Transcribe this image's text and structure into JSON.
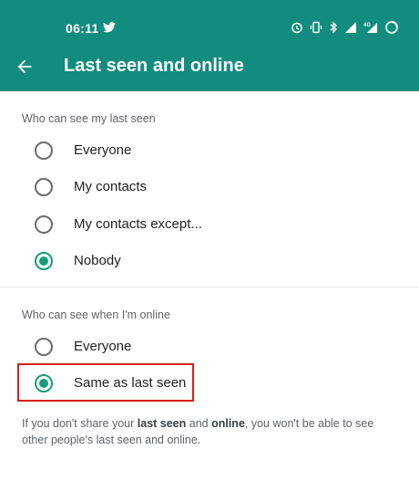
{
  "status_bar": {
    "time": "06:11",
    "icons": [
      "twitter-icon",
      "alarm-icon",
      "vibrate-icon",
      "bluetooth-icon",
      "signal-icon",
      "4g-icon",
      "battery-icon"
    ]
  },
  "header": {
    "title": "Last seen and online",
    "color": "#128c7e"
  },
  "last_seen": {
    "section_title": "Who can see my last seen",
    "options": [
      {
        "label": "Everyone",
        "selected": false
      },
      {
        "label": "My contacts",
        "selected": false
      },
      {
        "label": "My contacts except...",
        "selected": false
      },
      {
        "label": "Nobody",
        "selected": true
      }
    ]
  },
  "online": {
    "section_title": "Who can see when I'm online",
    "options": [
      {
        "label": "Everyone",
        "selected": false
      },
      {
        "label": "Same as last seen",
        "selected": true
      }
    ]
  },
  "note": {
    "p1": "If you don't share your ",
    "b1": "last seen",
    "p2": " and ",
    "b2": "online",
    "p3": ", you won't be able to see other people's last seen and online."
  },
  "colors": {
    "accent": "#1a9c7a",
    "highlight": "#d81e1e"
  }
}
